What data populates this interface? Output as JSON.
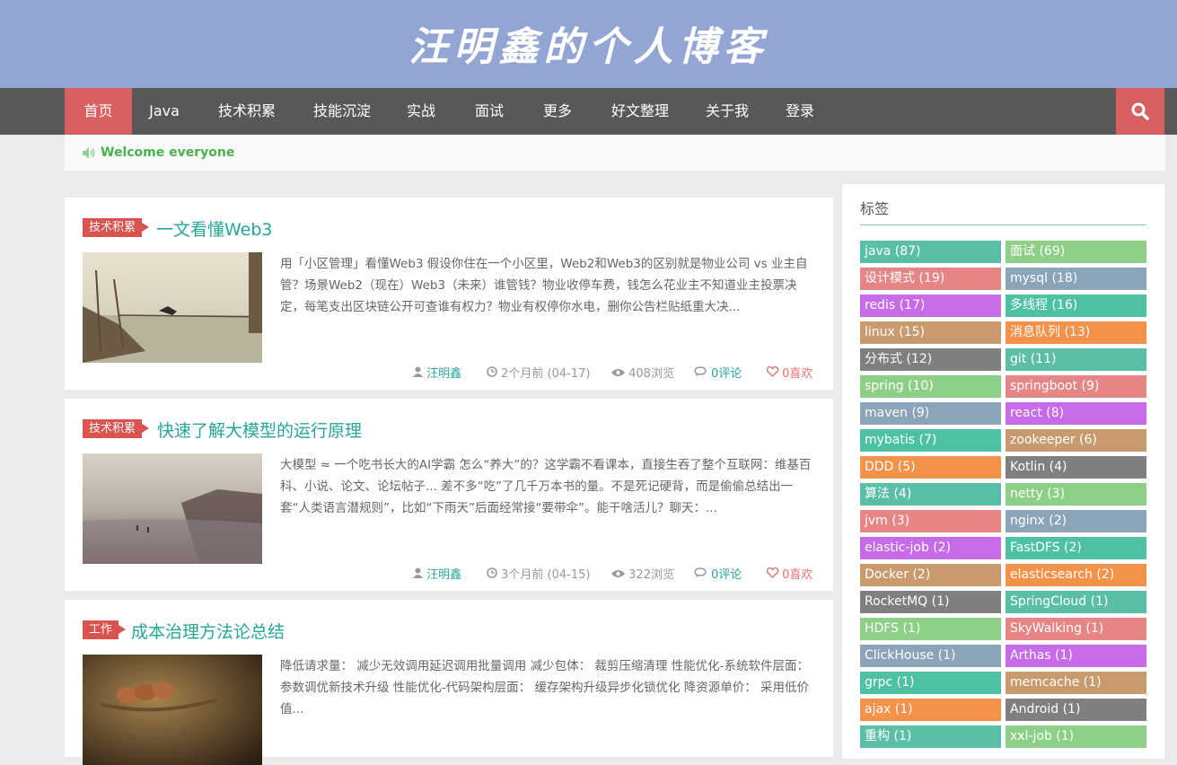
{
  "site": {
    "title": "汪明鑫的个人博客"
  },
  "nav": {
    "items": [
      "首页",
      "Java",
      "技术积累",
      "技能沉淀",
      "实战",
      "面试",
      "更多",
      "好文整理",
      "关于我",
      "登录"
    ],
    "search_icon": "search-icon"
  },
  "welcome": {
    "text": "Welcome everyone"
  },
  "posts": [
    {
      "tag": "技术积累",
      "title": "一文看懂Web3",
      "excerpt": "用「小区管理」看懂Web3 假设你住在一个小区里，Web2和Web3的区别就是物业公司 vs 业主自管？场景Web2（现在）Web3（未来）谁管钱？物业收停车费，钱怎么花业主不知道业主投票决定，每笔支出区块链公开可查谁有权力？物业有权停你水电，删你公告栏贴纸重大决...",
      "author": "汪明鑫",
      "time": "2个月前 (04-17)",
      "views": "408浏览",
      "comments": "0评论",
      "likes": "0喜欢"
    },
    {
      "tag": "技术积累",
      "title": "快速了解大模型的运行原理",
      "excerpt": "大模型 ≈ 一个吃书长大的AI学霸 怎么“养大”的？这学霸不看课本，直接生吞了整个互联网：维基百科、小说、论文、论坛帖子... 差不多“吃”了几千万本书的量。不是死记硬背，而是偷偷总结出一套“人类语言潜规则”，比如“下雨天”后面经常接“要带伞”。能干啥活儿？聊天：...",
      "author": "汪明鑫",
      "time": "3个月前 (04-15)",
      "views": "322浏览",
      "comments": "0评论",
      "likes": "0喜欢"
    },
    {
      "tag": "工作",
      "title": "成本治理方法论总结",
      "excerpt": "降低请求量： 减少无效调用延迟调用批量调用 减少包体： 裁剪压缩清理 性能优化-系统软件层面： 参数调优新技术升级 性能优化-代码架构层面： 缓存架构升级异步化锁优化 降资源单价： 采用低价值...",
      "author": "",
      "time": "",
      "views": "",
      "comments": "",
      "likes": ""
    }
  ],
  "sidebar": {
    "title": "标签",
    "tags": [
      {
        "label": "java (87)",
        "color": "#5bbfa8"
      },
      {
        "label": "面试 (69)",
        "color": "#8ecf88"
      },
      {
        "label": "设计模式 (19)",
        "color": "#e68585"
      },
      {
        "label": "mysql (18)",
        "color": "#8ba4b8"
      },
      {
        "label": "redis (17)",
        "color": "#c86be8"
      },
      {
        "label": "多线程 (16)",
        "color": "#4dc1a3"
      },
      {
        "label": "linux (15)",
        "color": "#c99a6e"
      },
      {
        "label": "消息队列 (13)",
        "color": "#f5924a"
      },
      {
        "label": "分布式 (12)",
        "color": "#7f7f7f"
      },
      {
        "label": "git (11)",
        "color": "#5bbfa8"
      },
      {
        "label": "spring (10)",
        "color": "#8ecf88"
      },
      {
        "label": "springboot (9)",
        "color": "#e68585"
      },
      {
        "label": "maven (9)",
        "color": "#8ba4b8"
      },
      {
        "label": "react (8)",
        "color": "#c86be8"
      },
      {
        "label": "mybatis (7)",
        "color": "#4dc1a3"
      },
      {
        "label": "zookeeper (6)",
        "color": "#c99a6e"
      },
      {
        "label": "DDD (5)",
        "color": "#f5924a"
      },
      {
        "label": "Kotlin (4)",
        "color": "#7f7f7f"
      },
      {
        "label": "算法 (4)",
        "color": "#5bbfa8"
      },
      {
        "label": "netty (3)",
        "color": "#8ecf88"
      },
      {
        "label": "jvm (3)",
        "color": "#e68585"
      },
      {
        "label": "nginx (2)",
        "color": "#8ba4b8"
      },
      {
        "label": "elastic-job (2)",
        "color": "#c86be8"
      },
      {
        "label": "FastDFS (2)",
        "color": "#4dc1a3"
      },
      {
        "label": "Docker (2)",
        "color": "#c99a6e"
      },
      {
        "label": "elasticsearch (2)",
        "color": "#f5924a"
      },
      {
        "label": "RocketMQ (1)",
        "color": "#7f7f7f"
      },
      {
        "label": "SpringCloud (1)",
        "color": "#5bbfa8"
      },
      {
        "label": "HDFS (1)",
        "color": "#8ecf88"
      },
      {
        "label": "SkyWalking (1)",
        "color": "#e68585"
      },
      {
        "label": "ClickHouse (1)",
        "color": "#8ba4b8"
      },
      {
        "label": "Arthas (1)",
        "color": "#c86be8"
      },
      {
        "label": "grpc (1)",
        "color": "#4dc1a3"
      },
      {
        "label": "memcache (1)",
        "color": "#c99a6e"
      },
      {
        "label": "ajax (1)",
        "color": "#f5924a"
      },
      {
        "label": "Android (1)",
        "color": "#7f7f7f"
      },
      {
        "label": "重构 (1)",
        "color": "#5bbfa8"
      },
      {
        "label": "xxl-job (1)",
        "color": "#8ecf88"
      }
    ]
  }
}
